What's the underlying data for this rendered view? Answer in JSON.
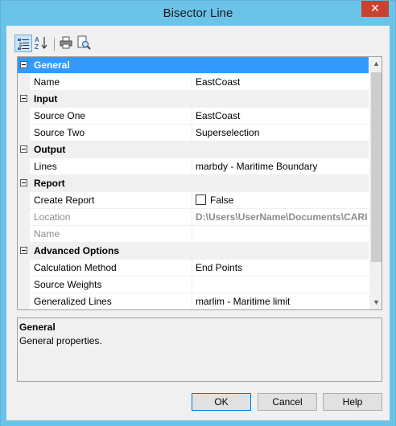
{
  "window": {
    "title": "Bisector Line",
    "close_glyph": "✕"
  },
  "toolbar": {
    "buttons": [
      {
        "icon": "categorized-icon",
        "active": true
      },
      {
        "icon": "alphabetical-sort-icon",
        "active": false
      },
      {
        "icon": "print-icon",
        "active": false
      },
      {
        "icon": "print-preview-icon",
        "active": false
      }
    ]
  },
  "grid": {
    "rows": [
      {
        "type": "category",
        "label": "General",
        "selected": true
      },
      {
        "type": "property",
        "name": "Name",
        "value": "EastCoast"
      },
      {
        "type": "category",
        "label": "Input"
      },
      {
        "type": "property",
        "name": "Source One",
        "value": "EastCoast"
      },
      {
        "type": "property",
        "name": "Source Two",
        "value": "Superselection"
      },
      {
        "type": "category",
        "label": "Output"
      },
      {
        "type": "property",
        "name": "Lines",
        "value": "marbdy - Maritime Boundary"
      },
      {
        "type": "category",
        "label": "Report"
      },
      {
        "type": "property",
        "name": "Create Report",
        "value": "False",
        "checkbox": true
      },
      {
        "type": "property",
        "name": "Location",
        "value": "D:\\Users\\UserName\\Documents\\CARI",
        "disabled": true
      },
      {
        "type": "property",
        "name": "Name",
        "value": "",
        "disabled": true
      },
      {
        "type": "category",
        "label": "Advanced Options"
      },
      {
        "type": "property",
        "name": "Calculation Method",
        "value": "End Points"
      },
      {
        "type": "property",
        "name": "Source Weights",
        "value": ""
      },
      {
        "type": "property",
        "name": "Generalized Lines",
        "value": "marlim - Maritime limit"
      }
    ]
  },
  "description": {
    "title": "General",
    "text": "General properties."
  },
  "buttons": {
    "ok": "OK",
    "cancel": "Cancel",
    "help": "Help"
  },
  "colors": {
    "titlebar": "#6cc3e8",
    "selection": "#3399ff",
    "close": "#c7432f"
  }
}
